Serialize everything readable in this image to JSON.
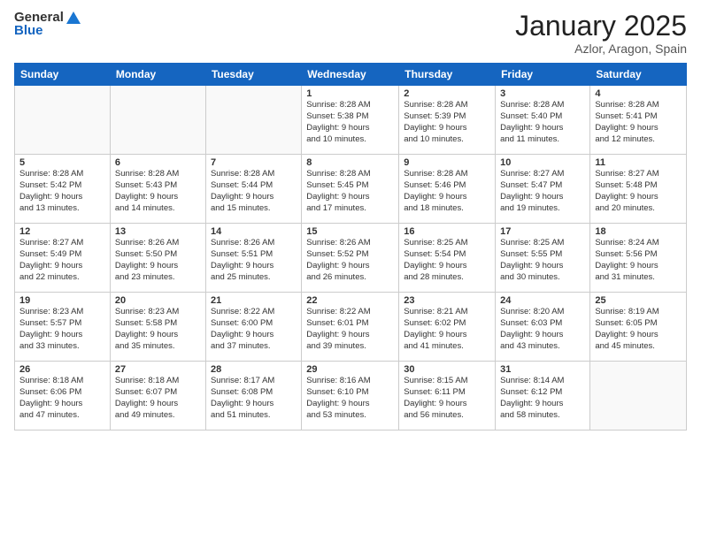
{
  "header": {
    "logo_general": "General",
    "logo_blue": "Blue",
    "month": "January 2025",
    "location": "Azlor, Aragon, Spain"
  },
  "weekdays": [
    "Sunday",
    "Monday",
    "Tuesday",
    "Wednesday",
    "Thursday",
    "Friday",
    "Saturday"
  ],
  "weeks": [
    [
      {
        "day": "",
        "info": ""
      },
      {
        "day": "",
        "info": ""
      },
      {
        "day": "",
        "info": ""
      },
      {
        "day": "1",
        "info": "Sunrise: 8:28 AM\nSunset: 5:38 PM\nDaylight: 9 hours\nand 10 minutes."
      },
      {
        "day": "2",
        "info": "Sunrise: 8:28 AM\nSunset: 5:39 PM\nDaylight: 9 hours\nand 10 minutes."
      },
      {
        "day": "3",
        "info": "Sunrise: 8:28 AM\nSunset: 5:40 PM\nDaylight: 9 hours\nand 11 minutes."
      },
      {
        "day": "4",
        "info": "Sunrise: 8:28 AM\nSunset: 5:41 PM\nDaylight: 9 hours\nand 12 minutes."
      }
    ],
    [
      {
        "day": "5",
        "info": "Sunrise: 8:28 AM\nSunset: 5:42 PM\nDaylight: 9 hours\nand 13 minutes."
      },
      {
        "day": "6",
        "info": "Sunrise: 8:28 AM\nSunset: 5:43 PM\nDaylight: 9 hours\nand 14 minutes."
      },
      {
        "day": "7",
        "info": "Sunrise: 8:28 AM\nSunset: 5:44 PM\nDaylight: 9 hours\nand 15 minutes."
      },
      {
        "day": "8",
        "info": "Sunrise: 8:28 AM\nSunset: 5:45 PM\nDaylight: 9 hours\nand 17 minutes."
      },
      {
        "day": "9",
        "info": "Sunrise: 8:28 AM\nSunset: 5:46 PM\nDaylight: 9 hours\nand 18 minutes."
      },
      {
        "day": "10",
        "info": "Sunrise: 8:27 AM\nSunset: 5:47 PM\nDaylight: 9 hours\nand 19 minutes."
      },
      {
        "day": "11",
        "info": "Sunrise: 8:27 AM\nSunset: 5:48 PM\nDaylight: 9 hours\nand 20 minutes."
      }
    ],
    [
      {
        "day": "12",
        "info": "Sunrise: 8:27 AM\nSunset: 5:49 PM\nDaylight: 9 hours\nand 22 minutes."
      },
      {
        "day": "13",
        "info": "Sunrise: 8:26 AM\nSunset: 5:50 PM\nDaylight: 9 hours\nand 23 minutes."
      },
      {
        "day": "14",
        "info": "Sunrise: 8:26 AM\nSunset: 5:51 PM\nDaylight: 9 hours\nand 25 minutes."
      },
      {
        "day": "15",
        "info": "Sunrise: 8:26 AM\nSunset: 5:52 PM\nDaylight: 9 hours\nand 26 minutes."
      },
      {
        "day": "16",
        "info": "Sunrise: 8:25 AM\nSunset: 5:54 PM\nDaylight: 9 hours\nand 28 minutes."
      },
      {
        "day": "17",
        "info": "Sunrise: 8:25 AM\nSunset: 5:55 PM\nDaylight: 9 hours\nand 30 minutes."
      },
      {
        "day": "18",
        "info": "Sunrise: 8:24 AM\nSunset: 5:56 PM\nDaylight: 9 hours\nand 31 minutes."
      }
    ],
    [
      {
        "day": "19",
        "info": "Sunrise: 8:23 AM\nSunset: 5:57 PM\nDaylight: 9 hours\nand 33 minutes."
      },
      {
        "day": "20",
        "info": "Sunrise: 8:23 AM\nSunset: 5:58 PM\nDaylight: 9 hours\nand 35 minutes."
      },
      {
        "day": "21",
        "info": "Sunrise: 8:22 AM\nSunset: 6:00 PM\nDaylight: 9 hours\nand 37 minutes."
      },
      {
        "day": "22",
        "info": "Sunrise: 8:22 AM\nSunset: 6:01 PM\nDaylight: 9 hours\nand 39 minutes."
      },
      {
        "day": "23",
        "info": "Sunrise: 8:21 AM\nSunset: 6:02 PM\nDaylight: 9 hours\nand 41 minutes."
      },
      {
        "day": "24",
        "info": "Sunrise: 8:20 AM\nSunset: 6:03 PM\nDaylight: 9 hours\nand 43 minutes."
      },
      {
        "day": "25",
        "info": "Sunrise: 8:19 AM\nSunset: 6:05 PM\nDaylight: 9 hours\nand 45 minutes."
      }
    ],
    [
      {
        "day": "26",
        "info": "Sunrise: 8:18 AM\nSunset: 6:06 PM\nDaylight: 9 hours\nand 47 minutes."
      },
      {
        "day": "27",
        "info": "Sunrise: 8:18 AM\nSunset: 6:07 PM\nDaylight: 9 hours\nand 49 minutes."
      },
      {
        "day": "28",
        "info": "Sunrise: 8:17 AM\nSunset: 6:08 PM\nDaylight: 9 hours\nand 51 minutes."
      },
      {
        "day": "29",
        "info": "Sunrise: 8:16 AM\nSunset: 6:10 PM\nDaylight: 9 hours\nand 53 minutes."
      },
      {
        "day": "30",
        "info": "Sunrise: 8:15 AM\nSunset: 6:11 PM\nDaylight: 9 hours\nand 56 minutes."
      },
      {
        "day": "31",
        "info": "Sunrise: 8:14 AM\nSunset: 6:12 PM\nDaylight: 9 hours\nand 58 minutes."
      },
      {
        "day": "",
        "info": ""
      }
    ]
  ]
}
